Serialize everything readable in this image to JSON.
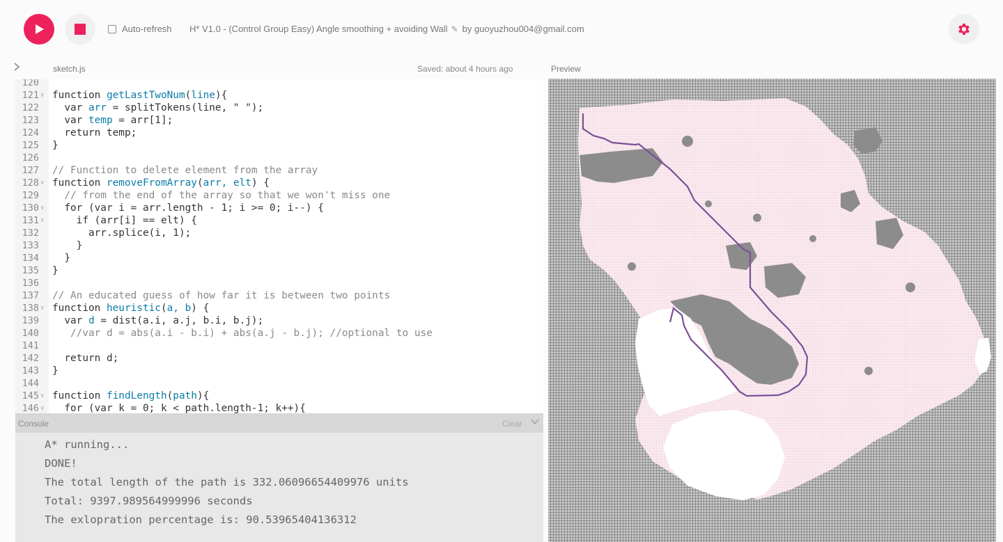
{
  "toolbar": {
    "auto_refresh_label": "Auto-refresh",
    "project_title": "H* V1.0 - (Control Group Easy) Angle smoothing + avoiding Wall",
    "byline": "by guoyuzhou004@gmail.com"
  },
  "editor": {
    "file_name": "sketch.js",
    "saved_status": "Saved: about 4 hours ago",
    "lines": [
      {
        "num": "120",
        "fold": false,
        "text": ""
      },
      {
        "num": "121",
        "fold": true,
        "text": "function getLastTwoNum(line){"
      },
      {
        "num": "122",
        "fold": false,
        "text": "  var arr = splitTokens(line, \" \");"
      },
      {
        "num": "123",
        "fold": false,
        "text": "  var temp = arr[1];"
      },
      {
        "num": "124",
        "fold": false,
        "text": "  return temp;"
      },
      {
        "num": "125",
        "fold": false,
        "text": "}"
      },
      {
        "num": "126",
        "fold": false,
        "text": ""
      },
      {
        "num": "127",
        "fold": false,
        "text": "// Function to delete element from the array"
      },
      {
        "num": "128",
        "fold": true,
        "text": "function removeFromArray(arr, elt) {"
      },
      {
        "num": "129",
        "fold": false,
        "text": "  // from the end of the array so that we won't miss one"
      },
      {
        "num": "130",
        "fold": true,
        "text": "  for (var i = arr.length - 1; i >= 0; i--) {"
      },
      {
        "num": "131",
        "fold": true,
        "text": "    if (arr[i] == elt) {"
      },
      {
        "num": "132",
        "fold": false,
        "text": "      arr.splice(i, 1);"
      },
      {
        "num": "133",
        "fold": false,
        "text": "    }"
      },
      {
        "num": "134",
        "fold": false,
        "text": "  }"
      },
      {
        "num": "135",
        "fold": false,
        "text": "}"
      },
      {
        "num": "136",
        "fold": false,
        "text": ""
      },
      {
        "num": "137",
        "fold": false,
        "text": "// An educated guess of how far it is between two points"
      },
      {
        "num": "138",
        "fold": true,
        "text": "function heuristic(a, b) {"
      },
      {
        "num": "139",
        "fold": false,
        "text": "  var d = dist(a.i, a.j, b.i, b.j);"
      },
      {
        "num": "140",
        "fold": false,
        "text": "   //var d = abs(a.i - b.i) + abs(a.j - b.j); //optional to use"
      },
      {
        "num": "141",
        "fold": false,
        "text": ""
      },
      {
        "num": "142",
        "fold": false,
        "text": "  return d;"
      },
      {
        "num": "143",
        "fold": false,
        "text": "}"
      },
      {
        "num": "144",
        "fold": false,
        "text": ""
      },
      {
        "num": "145",
        "fold": true,
        "text": "function findLength(path){"
      },
      {
        "num": "146",
        "fold": true,
        "text": "  for (var k = 0; k < path.length-1; k++){"
      }
    ]
  },
  "console": {
    "title": "Console",
    "clear_label": "Clear",
    "lines": [
      "A* running...",
      "DONE!",
      "The total length of the path is 332.06096654409976 units",
      "Total: 9397.989564999996 seconds",
      "The exlopration percentage is: 90.53965404136312"
    ]
  },
  "preview": {
    "label": "Preview"
  },
  "colors": {
    "accent": "#ed225d",
    "path": "#7a4f96",
    "explored": "#f7dde3",
    "wall": "#8c8c8c",
    "free": "#ffffff"
  }
}
